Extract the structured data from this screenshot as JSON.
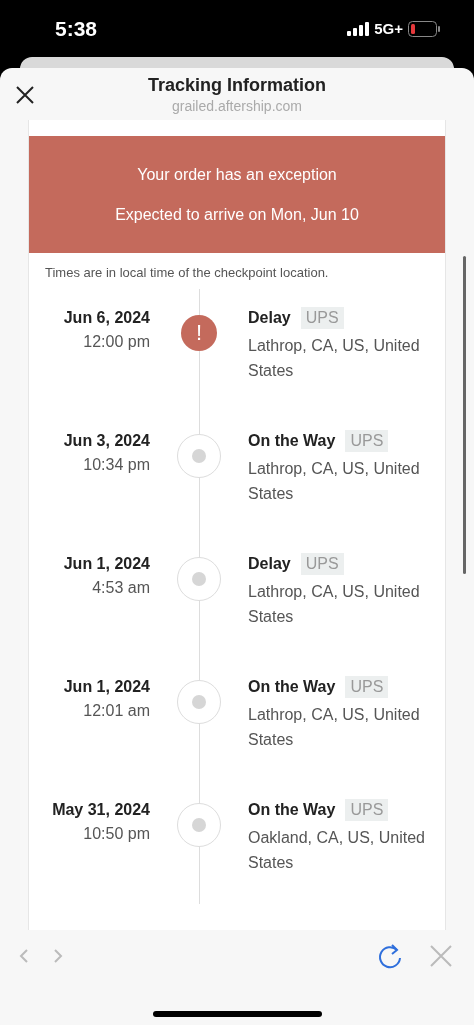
{
  "status_bar": {
    "time": "5:38",
    "network": "5G+"
  },
  "header": {
    "title": "Tracking Information",
    "subtitle": "grailed.aftership.com"
  },
  "banner": {
    "headline": "Your order has an exception",
    "expected": "Expected to arrive on Mon, Jun 10"
  },
  "note": "Times are in local time of the checkpoint location.",
  "events": [
    {
      "kind": "exception",
      "date": "Jun 6, 2024",
      "time": "12:00 pm",
      "status": "Delay",
      "carrier": "UPS",
      "location": "Lathrop, CA, US, United States",
      "marker": "!"
    },
    {
      "kind": "normal",
      "date": "Jun 3, 2024",
      "time": "10:34 pm",
      "status": "On the Way",
      "carrier": "UPS",
      "location": "Lathrop, CA, US, United States"
    },
    {
      "kind": "normal",
      "date": "Jun 1, 2024",
      "time": "4:53 am",
      "status": "Delay",
      "carrier": "UPS",
      "location": "Lathrop, CA, US, United States"
    },
    {
      "kind": "normal",
      "date": "Jun 1, 2024",
      "time": "12:01 am",
      "status": "On the Way",
      "carrier": "UPS",
      "location": "Lathrop, CA, US, United States"
    },
    {
      "kind": "normal",
      "date": "May 31, 2024",
      "time": "10:50 pm",
      "status": "On the Way",
      "carrier": "UPS",
      "location": "Oakland, CA, US, United States"
    }
  ],
  "toolbar": {
    "back_disabled": true,
    "forward_disabled": true
  }
}
